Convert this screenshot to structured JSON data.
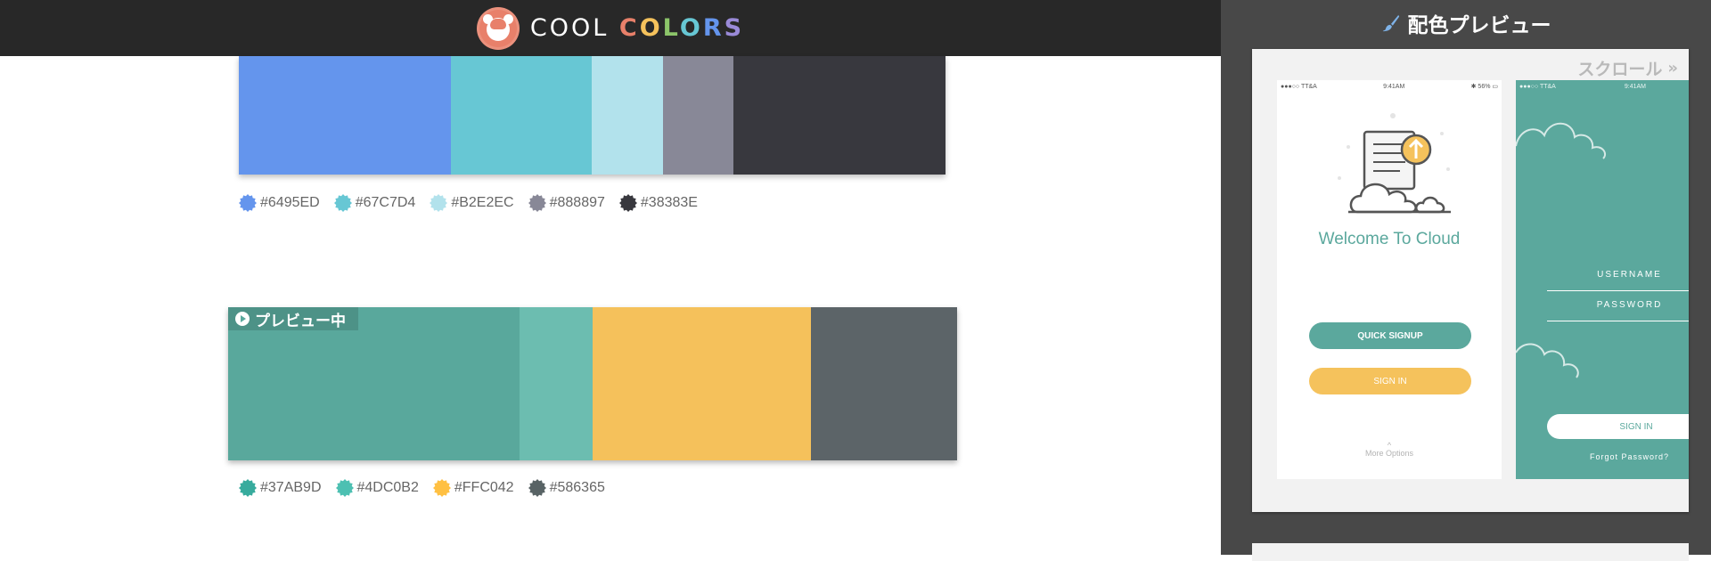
{
  "header": {
    "logo_text_1": "COOL ",
    "logo_letters": [
      {
        "ch": "C",
        "color": "#e8806a"
      },
      {
        "ch": "O",
        "color": "#f5c25c"
      },
      {
        "ch": "L",
        "color": "#8cc56a"
      },
      {
        "ch": "O",
        "color": "#67c7d4"
      },
      {
        "ch": "R",
        "color": "#6495ed"
      },
      {
        "ch": "S",
        "color": "#9a8ad8"
      }
    ]
  },
  "palettes": [
    {
      "swatches": [
        {
          "color": "#6495ED",
          "weight": 0.3
        },
        {
          "color": "#67C7D4",
          "weight": 0.2
        },
        {
          "color": "#B2E2EC",
          "weight": 0.1
        },
        {
          "color": "#888897",
          "weight": 0.1
        },
        {
          "color": "#38383E",
          "weight": 0.3
        }
      ],
      "codes": [
        "#6495ED",
        "#67C7D4",
        "#B2E2EC",
        "#888897",
        "#38383E"
      ]
    },
    {
      "preview_label": "プレビュー中",
      "swatches": [
        {
          "color": "#59A89C",
          "weight": 0.4
        },
        {
          "color": "#6CBDB0",
          "weight": 0.1
        },
        {
          "color": "#F5C15B",
          "weight": 0.3
        },
        {
          "color": "#5C6468",
          "weight": 0.2
        }
      ],
      "codes": [
        "#37AB9D",
        "#4DC0B2",
        "#FFC042",
        "#586365"
      ],
      "code_colors": [
        "#37AB9D",
        "#4DC0B2",
        "#FFC042",
        "#586365"
      ]
    }
  ],
  "sidebar": {
    "title": "配色プレビュー",
    "scroll_hint": "スクロール",
    "phone1": {
      "status_left": "●●●○○ TT&A",
      "status_time": "9:41AM",
      "status_right": "56%",
      "welcome": "Welcome To Cloud",
      "quick_signup": "QUICK SIGNUP",
      "sign_in": "SIGN IN",
      "more_options": "More Options"
    },
    "phone2": {
      "status_left": "●●●○○ TT&A",
      "status_time": "9:41AM",
      "username": "USERNAME",
      "password": "PASSWORD",
      "sign_in": "SIGN IN",
      "forgot": "Forgot Password?"
    }
  }
}
